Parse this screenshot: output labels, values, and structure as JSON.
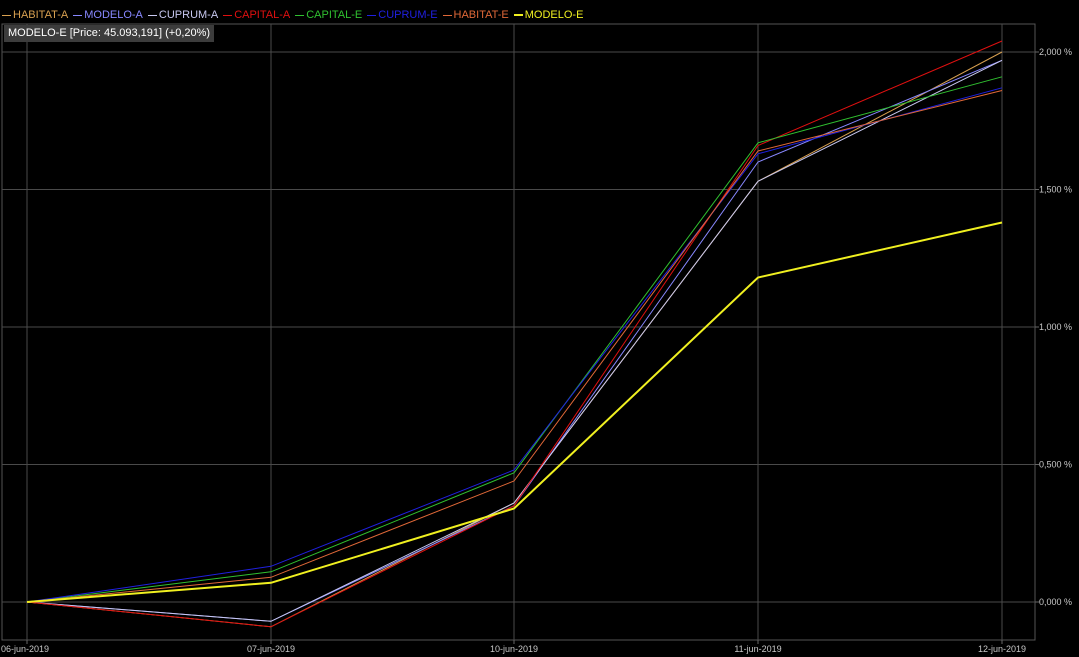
{
  "info": {
    "text": "MODELO-E [Price: 45.093,191] (+0,20%)"
  },
  "chart_data": {
    "type": "line",
    "x": [
      "06-jun-2019",
      "07-jun-2019",
      "10-jun-2019",
      "11-jun-2019",
      "12-jun-2019"
    ],
    "y_ticks": [
      "0,000 %",
      "0,500 %",
      "1,000 %",
      "1,500 %",
      "2,000 %"
    ],
    "y_tick_values": [
      0,
      0.5,
      1.0,
      1.5,
      2.0
    ],
    "ylim": [
      -0.14,
      2.05
    ],
    "grid": true,
    "legend_position": "top-left",
    "series": [
      {
        "name": "HABITAT-A",
        "color": "#d8a050",
        "width": 1,
        "values": [
          0,
          -0.09,
          0.36,
          1.53,
          2.0
        ]
      },
      {
        "name": "MODELO-A",
        "color": "#8888ff",
        "width": 1,
        "values": [
          0,
          -0.07,
          0.35,
          1.6,
          1.97
        ]
      },
      {
        "name": "CUPRUM-A",
        "color": "#c8c8f0",
        "width": 1,
        "values": [
          0,
          -0.07,
          0.36,
          1.53,
          1.97
        ]
      },
      {
        "name": "CAPITAL-A",
        "color": "#e01010",
        "width": 1,
        "values": [
          0,
          -0.09,
          0.35,
          1.66,
          2.04
        ]
      },
      {
        "name": "CAPITAL-E",
        "color": "#30c030",
        "width": 1,
        "values": [
          0,
          0.11,
          0.47,
          1.67,
          1.91
        ]
      },
      {
        "name": "CUPRUM-E",
        "color": "#2020e0",
        "width": 1,
        "values": [
          0,
          0.13,
          0.48,
          1.63,
          1.87
        ]
      },
      {
        "name": "HABITAT-E",
        "color": "#e06838",
        "width": 1,
        "values": [
          0,
          0.09,
          0.44,
          1.64,
          1.86
        ]
      },
      {
        "name": "MODELO-E",
        "color": "#f0f020",
        "width": 2,
        "values": [
          0,
          0.07,
          0.34,
          1.18,
          1.38
        ]
      }
    ]
  }
}
